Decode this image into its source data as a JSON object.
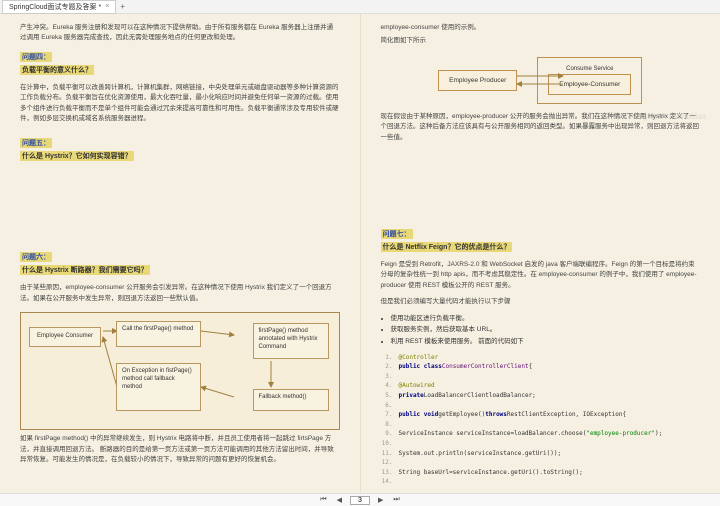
{
  "tab": {
    "title": "SpringCloud面试专题及答案 *",
    "close": "×",
    "add": "+"
  },
  "nav": {
    "page": "3"
  },
  "left": {
    "intro": "产生冲突。Eureka 服务注册和发现可以在这种情况下提供帮助。由于所有服务都在 Eureka 服务器上注册并通过调用 Eureka 服务器完成查找，因此无需处理服务地点的任何更改和处理。",
    "q4_label": "问题四：",
    "q4_title": "负载平衡的意义什么？",
    "q4_body": "在计算中，负载平衡可以改善跨计算机，计算机集群，网络链接，中央处理单元或磁盘驱动器等多种计算资源的工作负载分布。负载平衡旨在优化资源使用，最大化吞吐量，最小化响应时间并避免任何单一资源的过载。使用多个组件进行负载平衡而不是单个组件可能会通过冗余来提高可靠性和可用性。负载平衡通常涉及专用软件或硬件，例如多层交换机或域名系统服务器进程。",
    "q5_label": "问题五：",
    "q5_title": "什么是 Hystrix？它如何实现容错？",
    "q6_label": "问题六：",
    "q6_title": "什么是 Hystrix 断路器？我们需要它吗？",
    "q6_body": "由于某些原因，employee-consumer 公开服务会引发异常。在这种情况下使用 Hystrix 我们定义了一个回退方法。如果在公开服务中发生异常，则回退方法返回一些默认值。",
    "d2": {
      "ec": "Employee Consumer",
      "mid1": "Call the firstPage() method",
      "mid2": "On Exception in fistPage() method call fallback method",
      "r1": "firstPage() method annotated with Hystrix Command",
      "r2": "Fallback method()"
    },
    "q6_footer": "如果 firstPage method() 中的异常继续发生，则 Hystrix 电路将中断，并且员工使用者将一起跳过 firtsPage 方法，并直接调用回退方法。 断路器的目的是给第一页方法或第一页方法可能调用的其他方法留出时间，并导致异常恢复。可能发生的情况是，在负载较小的情况下，导致异常的问题有更好的恢复机会。"
  },
  "right": {
    "intro_top": "employee-consumer 使用的示例。",
    "intro_top2": "简化图如下所示",
    "d1": {
      "ep": "Employee Producer",
      "ec": "Employee-Consumer",
      "cs": "Consume Service"
    },
    "watermark": "https://blog.csdn.net/huidao",
    "r_body": "现在假设由于某种原因，employee-producer 公开的服务会抛出异常。我们在这种情况下使用 Hystrix 定义了一个回退方法。这种后备方法应该具有与公开服务相同的返回类型。如果暴露服务中出现异常，则回退方法将返回一些值。",
    "q7_label": "问题七：",
    "q7_title": "什么是 Netflix Feign？它的优点是什么？",
    "q7_body1": "Feign 是受到 Retrofit，JAXRS-2.0 和 WebSocket 启发的 java 客户端联编程序。Feign 的第一个目标是将约束分母的复杂性统一到 http apis，而不考虑其稳定性。在 employee-consumer 的例子中，我们使用了 employee-producer 使用 REST 模板公开的 REST 服务。",
    "q7_body2": "但是我们必须编写大量代码才能执行以下步骤",
    "bullets": [
      "使用功能区进行负载平衡。",
      "获取服务实例，然后获取基本 URL。",
      "利用 REST 模板来使用服务。 前面的代码如下"
    ],
    "code": [
      {
        "n": "1.",
        "anno": "@Controller"
      },
      {
        "n": "2.",
        "mod": "public class ",
        "cls": "ConsumerControllerClient",
        "txt": " {"
      },
      {
        "n": "3.",
        "txt": ""
      },
      {
        "n": "4.",
        "anno": "@Autowired"
      },
      {
        "n": "5.",
        "mod": "private ",
        "type": "LoadBalancerClient ",
        "var": "loadBalancer;"
      },
      {
        "n": "6.",
        "txt": ""
      },
      {
        "n": "7.",
        "mod": "public void ",
        "meth": "getEmployee",
        "txt": "() ",
        "mod2": "throws ",
        "ex": "RestClientException, IOException",
        "txt2": " {"
      },
      {
        "n": "8.",
        "txt": ""
      },
      {
        "n": "9.",
        "ind": "    ",
        "txt1": "ServiceInstance serviceInstance=loadBalancer.choose(",
        "str": "\"employee-producer\"",
        "txt2": ");"
      },
      {
        "n": "10.",
        "txt": ""
      },
      {
        "n": "11.",
        "ind": "    ",
        "txt1": "System.out.println(serviceInstance.getUri());"
      },
      {
        "n": "12.",
        "txt": ""
      },
      {
        "n": "13.",
        "ind": "    ",
        "txt1": "String baseUrl=serviceInstance.getUri().toString();"
      },
      {
        "n": "14.",
        "txt": ""
      }
    ]
  }
}
